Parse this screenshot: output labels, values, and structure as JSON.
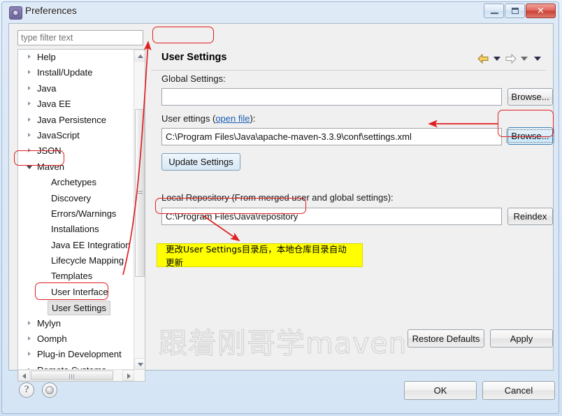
{
  "window": {
    "title": "Preferences",
    "icon": "preferences-gear-icon",
    "minimize_label": "Minimize",
    "maximize_label": "Maximize",
    "close_label": "Close"
  },
  "filter": {
    "placeholder": "type filter text",
    "value": ""
  },
  "tree": {
    "items": [
      {
        "label": "Help",
        "level": 0,
        "state": "collapsed",
        "selected": false
      },
      {
        "label": "Install/Update",
        "level": 0,
        "state": "collapsed",
        "selected": false
      },
      {
        "label": "Java",
        "level": 0,
        "state": "collapsed",
        "selected": false
      },
      {
        "label": "Java EE",
        "level": 0,
        "state": "collapsed",
        "selected": false
      },
      {
        "label": "Java Persistence",
        "level": 0,
        "state": "collapsed",
        "selected": false
      },
      {
        "label": "JavaScript",
        "level": 0,
        "state": "collapsed",
        "selected": false
      },
      {
        "label": "JSON",
        "level": 0,
        "state": "collapsed",
        "selected": false
      },
      {
        "label": "Maven",
        "level": 0,
        "state": "expanded",
        "selected": false
      },
      {
        "label": "Archetypes",
        "level": 1,
        "state": "leaf",
        "selected": false
      },
      {
        "label": "Discovery",
        "level": 1,
        "state": "leaf",
        "selected": false
      },
      {
        "label": "Errors/Warnings",
        "level": 1,
        "state": "leaf",
        "selected": false
      },
      {
        "label": "Installations",
        "level": 1,
        "state": "leaf",
        "selected": false
      },
      {
        "label": "Java EE Integration",
        "level": 1,
        "state": "leaf",
        "selected": false
      },
      {
        "label": "Lifecycle Mapping",
        "level": 1,
        "state": "leaf",
        "selected": false
      },
      {
        "label": "Templates",
        "level": 1,
        "state": "leaf",
        "selected": false
      },
      {
        "label": "User Interface",
        "level": 1,
        "state": "leaf",
        "selected": false
      },
      {
        "label": "User Settings",
        "level": 1,
        "state": "leaf",
        "selected": true
      },
      {
        "label": "Mylyn",
        "level": 0,
        "state": "collapsed",
        "selected": false
      },
      {
        "label": "Oomph",
        "level": 0,
        "state": "collapsed",
        "selected": false
      },
      {
        "label": "Plug-in Development",
        "level": 0,
        "state": "collapsed",
        "selected": false
      },
      {
        "label": "Remote Systems",
        "level": 0,
        "state": "collapsed",
        "selected": false
      }
    ]
  },
  "pane": {
    "title": "User Settings",
    "nav": {
      "back_icon": "back-arrow-icon",
      "back_menu_icon": "chevron-down-icon",
      "forward_icon": "forward-arrow-icon",
      "forward_menu_icon": "chevron-down-icon",
      "view_menu_icon": "chevron-down-icon"
    },
    "global_settings": {
      "label": "Global Settings:",
      "label_mnemonic": "S",
      "value": "",
      "browse_label": "Browse..."
    },
    "user_settings": {
      "label_before": "User ",
      "label_mnemonic": "S",
      "label_mid": "ettings (",
      "link": "open file",
      "label_after": "):",
      "value": "C:\\Program Files\\Java\\apache-maven-3.3.9\\conf\\settings.xml",
      "browse_label": "Browse...",
      "update_label": "Update Settings"
    },
    "local_repository": {
      "label": "Local Repository (From merged user and global settings):",
      "value": "C:\\Program Files\\Java\\repository",
      "reindex_label": "Reindex",
      "reindex_mnemonic": "i"
    },
    "watermark": "跟着刚哥学maven",
    "restore_defaults_label": "Restore Defaults",
    "restore_defaults_mnemonic": "D",
    "apply_label": "Apply",
    "apply_mnemonic": "A"
  },
  "footer": {
    "help_icon": "question-mark-icon",
    "status_icon": "status-indicator-icon",
    "ok_label": "OK",
    "cancel_label": "Cancel"
  },
  "annotations": {
    "note_text": "更改User Settings目录后，本地仓库目录自动更新",
    "highlight_color": "#e02020",
    "note_background": "#ffff00",
    "boxes": [
      "pane-title-User-Settings",
      "tree-item-Maven",
      "tree-item-User-Settings",
      "user-settings-browse-button",
      "local-repository-value"
    ]
  }
}
